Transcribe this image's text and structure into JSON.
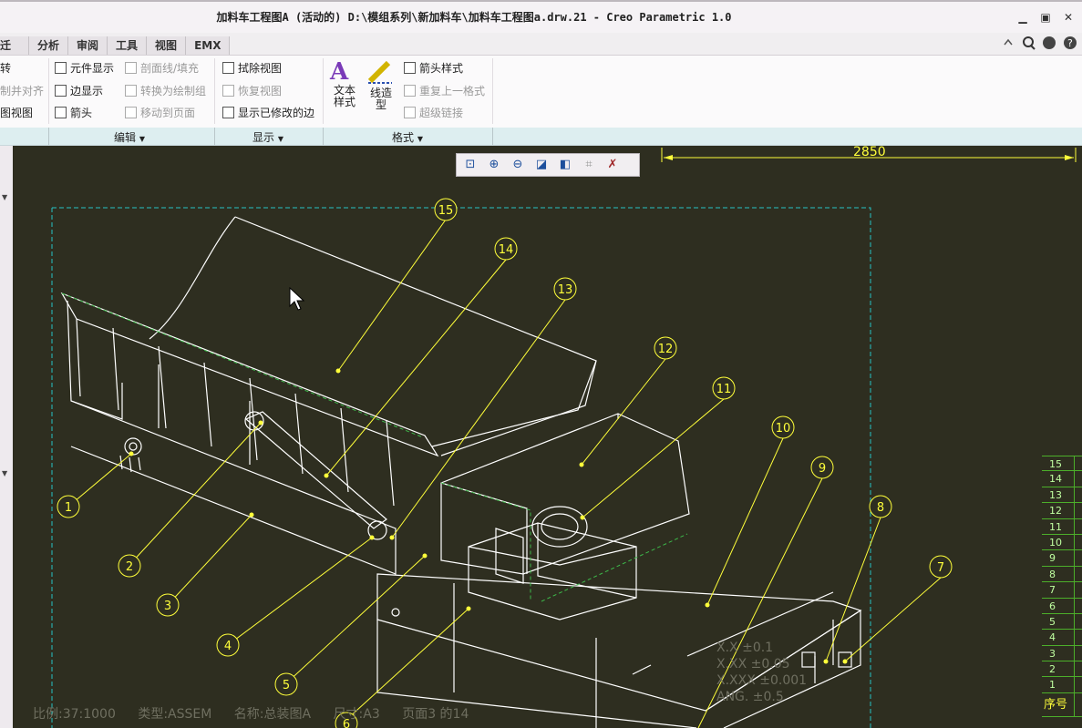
{
  "window": {
    "title": "加料车工程图A (活动的) D:\\模组系列\\新加料车\\加料车工程图a.drw.21 - Creo Parametric 1.0",
    "controls": [
      "▭",
      "▣",
      "✕"
    ]
  },
  "tabs": [
    "迁移",
    "分析",
    "审阅",
    "工具",
    "视图",
    "EMX"
  ],
  "ribbon": {
    "left_partial": [
      "转",
      "制并对齐",
      "图视图"
    ],
    "col1": [
      "元件显示",
      "边显示",
      "箭头"
    ],
    "col2": [
      "剖面线/填充",
      "转换为绘制组",
      "移动到页面"
    ],
    "col3": [
      "拭除视图",
      "恢复视图",
      "显示已修改的边"
    ],
    "text_style": "文本\n样式",
    "line_style": "线造\n型",
    "col4": [
      "箭头样式",
      "重复上一格式",
      "超级链接"
    ],
    "groups": [
      "编辑",
      "显示",
      "格式"
    ]
  },
  "drawing": {
    "dimension": "2850",
    "balloons": [
      "1",
      "2",
      "3",
      "4",
      "5",
      "6",
      "7",
      "8",
      "9",
      "10",
      "11",
      "12",
      "13",
      "14",
      "15"
    ],
    "tolerance": [
      "X.X   ±0.1",
      "X.XX  ±0.05",
      "X.XXX ±0.001",
      "ANG.  ±0.5"
    ],
    "bom_rows": [
      "15",
      "14",
      "13",
      "12",
      "11",
      "10",
      "9",
      "8",
      "7",
      "6",
      "5",
      "4",
      "3",
      "2",
      "1"
    ],
    "bom_header": "序号"
  },
  "status": {
    "scale": "比例:37:1000",
    "type": "类型:ASSEM",
    "name": "名称:总装图A",
    "size": "尺寸:A3",
    "page": "页面3   的14"
  },
  "colors": {
    "canvas_bg": "#2e2e20",
    "geometry": "#ffffff",
    "balloon": "#ffff3a",
    "leader": "#ffff3a",
    "border_dashed": "#26c3c3",
    "bom_line": "#4caf2a"
  }
}
